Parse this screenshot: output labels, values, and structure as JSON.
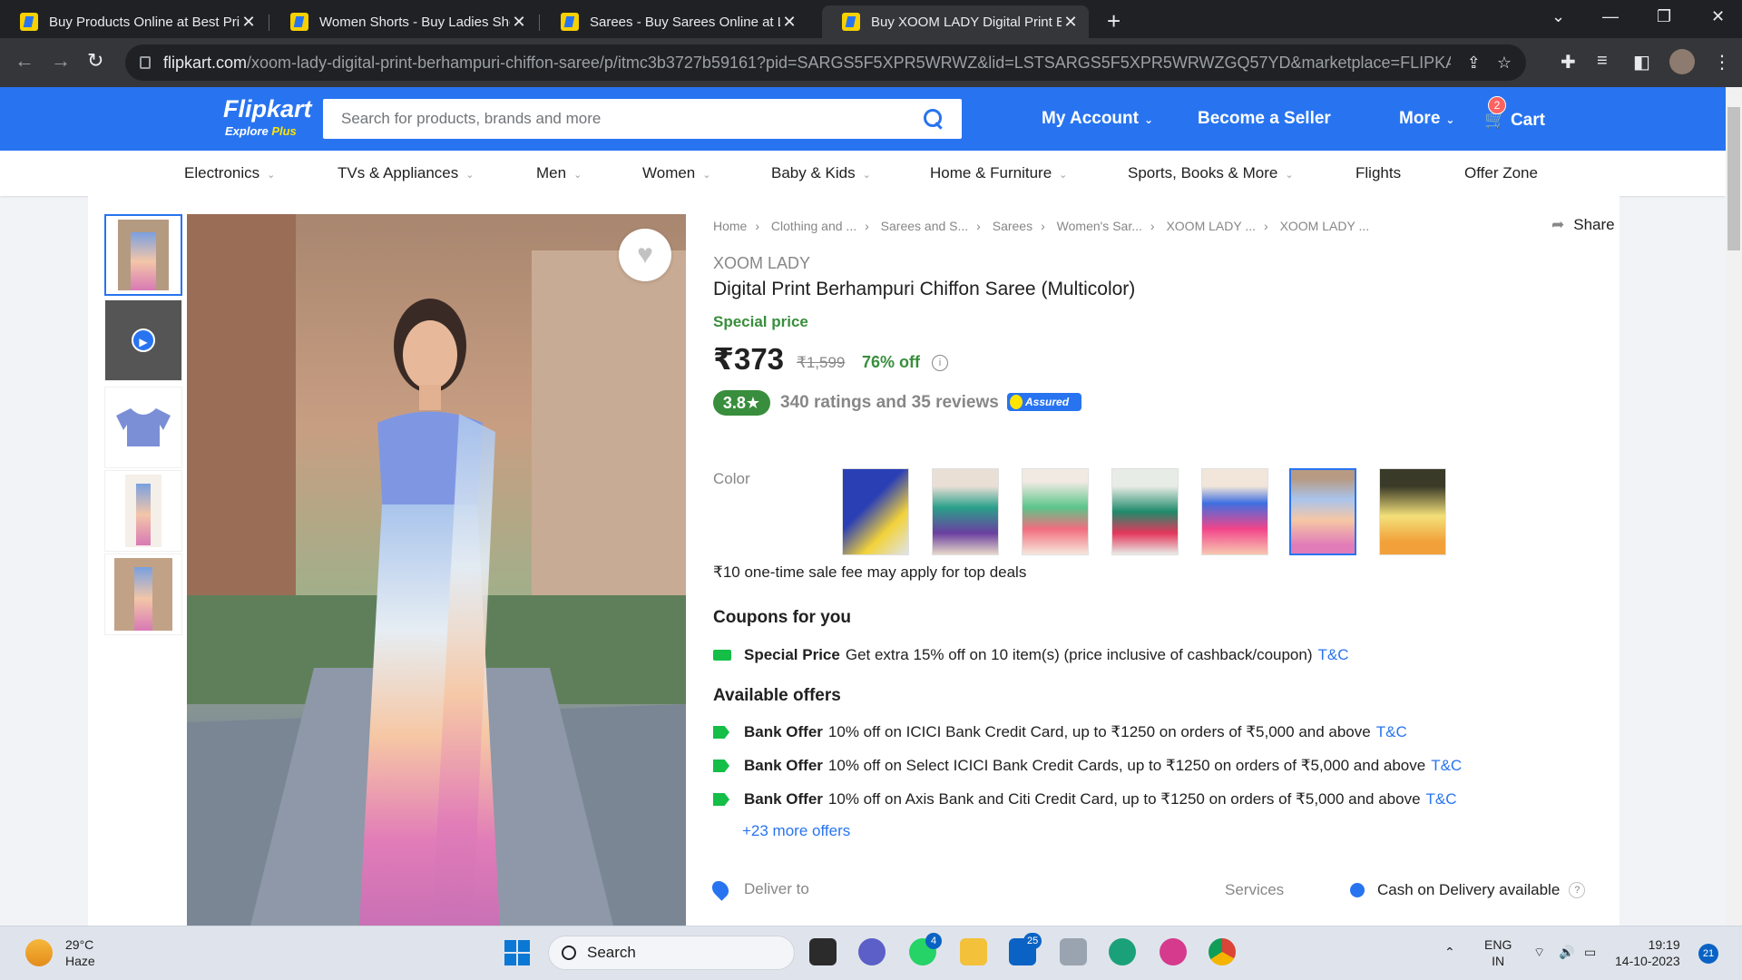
{
  "browser": {
    "tabs": [
      {
        "title": "Buy Products Online at Best Pric",
        "active": false
      },
      {
        "title": "Women Shorts - Buy Ladies Sho",
        "active": false
      },
      {
        "title": "Sarees - Buy Sarees Online at Lo",
        "active": false
      },
      {
        "title": "Buy XOOM LADY Digital Print Be",
        "active": true
      }
    ],
    "url_domain": "flipkart.com",
    "url_path": "/xoom-lady-digital-print-berhampuri-chiffon-saree/p/itmc3b3727b59161?pid=SARGS5F5XPR5WRWZ&lid=LSTSARGS5F5XPR5WRWZGQ57YD&marketplace=FLIPKART&store..."
  },
  "header": {
    "logo": "Flipkart",
    "logo_sub_a": "Explore",
    "logo_sub_b": "Plus",
    "search_placeholder": "Search for products, brands and more",
    "my_account": "My Account",
    "become_seller": "Become a Seller",
    "more": "More",
    "cart": "Cart",
    "cart_count": "2"
  },
  "categories": [
    "Electronics",
    "TVs & Appliances",
    "Men",
    "Women",
    "Baby & Kids",
    "Home & Furniture",
    "Sports, Books & More",
    "Flights",
    "Offer Zone"
  ],
  "breadcrumbs": [
    "Home",
    "Clothing and ...",
    "Sarees and S...",
    "Sarees",
    "Women's Sar...",
    "XOOM LADY ...",
    "XOOM LADY ..."
  ],
  "product": {
    "share": "Share",
    "brand": "XOOM LADY",
    "title": "Digital Print Berhampuri Chiffon Saree  (Multicolor)",
    "special_price": "Special price",
    "price": "₹373",
    "mrp": "₹1,599",
    "discount": "76% off",
    "rating": "3.8★",
    "ratings_text": "340 ratings and 35 reviews",
    "assured": "Assured",
    "color_label": "Color",
    "sale_fee": "₹10 one-time sale fee may apply for top deals"
  },
  "coupons": {
    "heading": "Coupons for you",
    "item": {
      "bold": "Special Price",
      "text": "Get extra 15% off on 10 item(s) (price inclusive of cashback/coupon)",
      "link": "T&C"
    }
  },
  "offers": {
    "heading": "Available offers",
    "items": [
      {
        "bold": "Bank Offer",
        "text": "10% off on ICICI Bank Credit Card, up to ₹1250 on orders of ₹5,000 and above",
        "link": "T&C"
      },
      {
        "bold": "Bank Offer",
        "text": "10% off on Select ICICI Bank Credit Cards, up to ₹1250 on orders of ₹5,000 and above",
        "link": "T&C"
      },
      {
        "bold": "Bank Offer",
        "text": "10% off on Axis Bank and Citi Credit Card, up to ₹1250 on orders of ₹5,000 and above",
        "link": "T&C"
      }
    ],
    "more": "+23 more offers"
  },
  "delivery": {
    "deliver_to": "Deliver to",
    "services": "Services",
    "cod": "Cash on Delivery available"
  },
  "taskbar": {
    "temp": "29°C",
    "weather": "Haze",
    "search": "Search",
    "whatsapp_badge": "4",
    "mail_badge": "25",
    "lang1": "ENG",
    "lang2": "IN",
    "time": "19:19",
    "date": "14-10-2023",
    "notifications": "21"
  },
  "colors": {
    "brand_blue": "#2874f0",
    "green": "#388e3c",
    "yellow": "#ffe500"
  }
}
